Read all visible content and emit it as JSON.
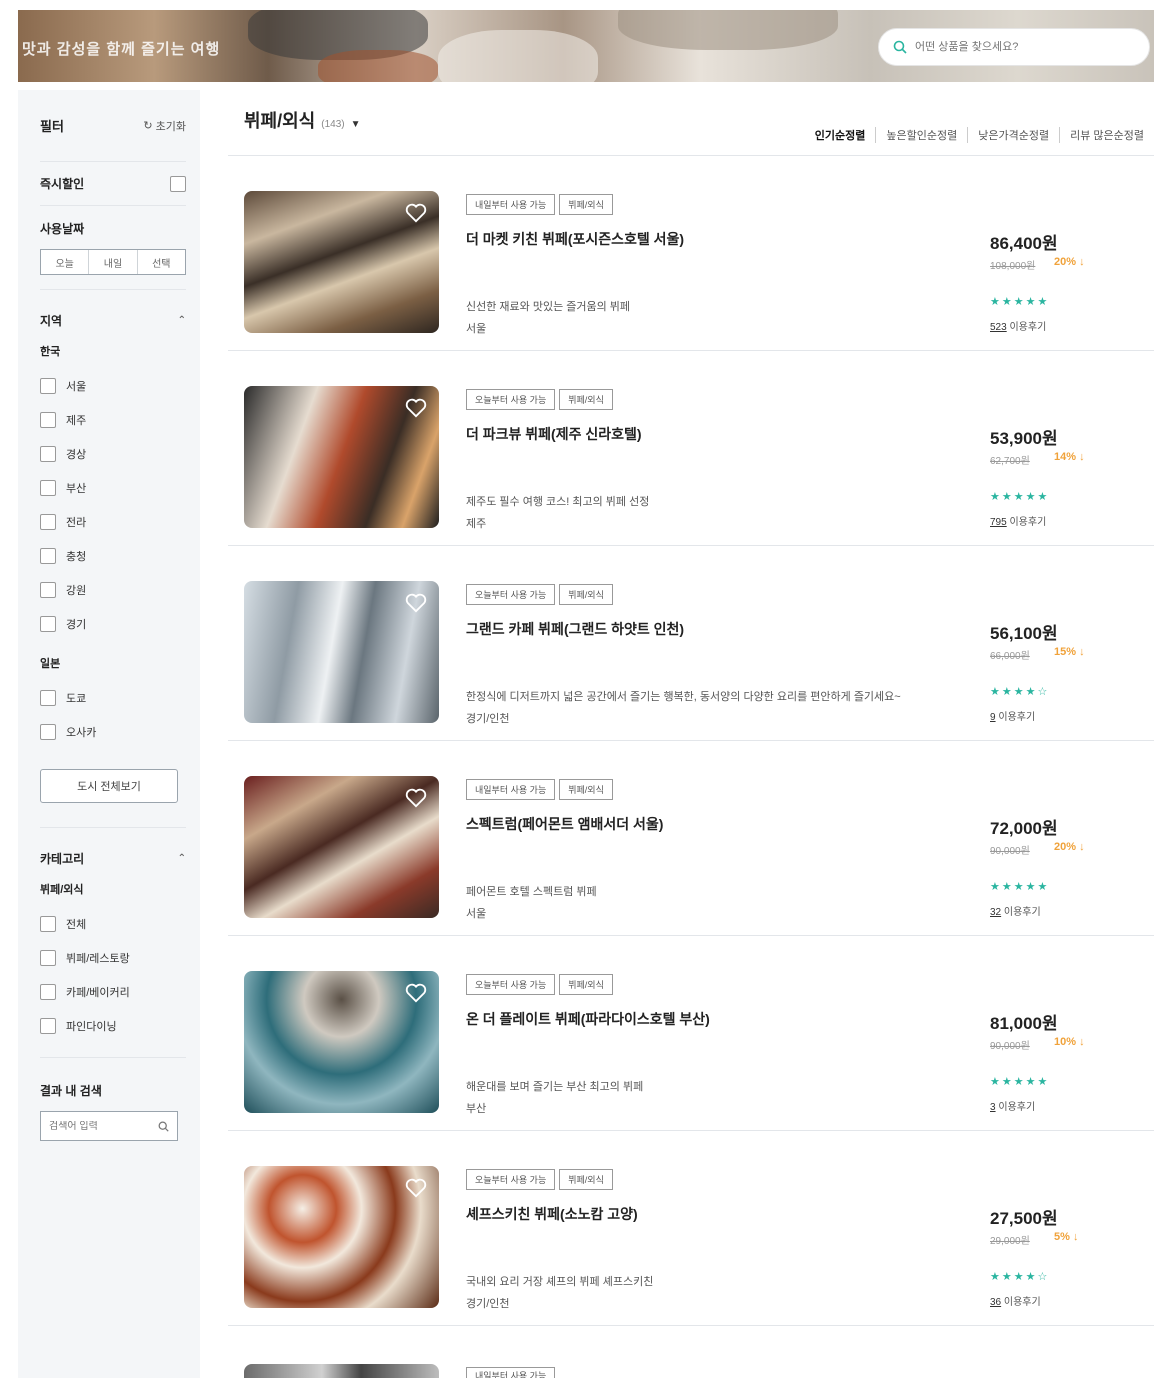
{
  "banner": {
    "text": "맛과 감성을 함께 즐기는 여행",
    "search_placeholder": "어떤 상품을 찾으세요?"
  },
  "sidebar": {
    "title": "필터",
    "reset": "초기화",
    "instant": "즉시할인",
    "date_title": "사용날짜",
    "date_options": [
      "오늘",
      "내일",
      "선택"
    ],
    "region_title": "지역",
    "korea_title": "한국",
    "korea_cities": [
      "서울",
      "제주",
      "경상",
      "부산",
      "전라",
      "충청",
      "강원",
      "경기"
    ],
    "japan_title": "일본",
    "japan_cities": [
      "도쿄",
      "오사카"
    ],
    "more_cities": "도시 전체보기",
    "category_title": "카테고리",
    "category_sub": "뷔페/외식",
    "categories": [
      "전체",
      "뷔페/레스토랑",
      "카페/베이커리",
      "파인다이닝"
    ],
    "result_search_title": "결과 내 검색",
    "result_search_placeholder": "검색어 입력"
  },
  "main": {
    "category_title": "뷔페/외식",
    "category_count": "(143)",
    "sorts": [
      "인기순정렬",
      "높은할인순정렬",
      "낮은가격순정렬",
      "리뷰 많은순정렬"
    ]
  },
  "products": [
    {
      "tags": [
        "내일부터 사용 가능",
        "뷔페/외식"
      ],
      "name": "더 마켓 키친 뷔페(포시즌스호텔 서울)",
      "desc": "신선한 재료와 맛있는 즐거움의 뷔페",
      "loc": "서울",
      "price": "86,400원",
      "orig": "108,000원",
      "disc": "20% ↓",
      "stars": "★★★★★",
      "review_count": "523",
      "review_label": "이용후기"
    },
    {
      "tags": [
        "오늘부터 사용 가능",
        "뷔페/외식"
      ],
      "name": "더 파크뷰 뷔페(제주 신라호텔)",
      "desc": "제주도 필수 여행 코스! 최고의 뷔페 선정",
      "loc": "제주",
      "price": "53,900원",
      "orig": "62,700원",
      "disc": "14% ↓",
      "stars": "★★★★★",
      "review_count": "795",
      "review_label": "이용후기"
    },
    {
      "tags": [
        "오늘부터 사용 가능",
        "뷔페/외식"
      ],
      "name": "그랜드 카페 뷔페(그랜드 하얏트 인천)",
      "desc": "한정식에 디저트까지 넓은 공간에서 즐기는 행복한, 동서양의 다양한 요리를 편안하게 즐기세요~",
      "loc": "경기/인천",
      "price": "56,100원",
      "orig": "66,000원",
      "disc": "15% ↓",
      "stars": "★★★★☆",
      "review_count": "9",
      "review_label": "이용후기"
    },
    {
      "tags": [
        "내일부터 사용 가능",
        "뷔페/외식"
      ],
      "name": "스펙트럼(페어몬트 앰배서더 서울)",
      "desc": "페어몬트 호텔 스펙트럼 뷔페",
      "loc": "서울",
      "price": "72,000원",
      "orig": "90,000원",
      "disc": "20% ↓",
      "stars": "★★★★★",
      "review_count": "32",
      "review_label": "이용후기"
    },
    {
      "tags": [
        "오늘부터 사용 가능",
        "뷔페/외식"
      ],
      "name": "온 더 플레이트 뷔페(파라다이스호텔 부산)",
      "desc": "해운대를 보며 즐기는 부산 최고의 뷔페",
      "loc": "부산",
      "price": "81,000원",
      "orig": "90,000원",
      "disc": "10% ↓",
      "stars": "★★★★★",
      "review_count": "3",
      "review_label": "이용후기"
    },
    {
      "tags": [
        "오늘부터 사용 가능",
        "뷔페/외식"
      ],
      "name": "셰프스키친 뷔페(소노캄 고양)",
      "desc": "국내외 요리 거장 셰프의 뷔페 셰프스키친",
      "loc": "경기/인천",
      "price": "27,500원",
      "orig": "29,000원",
      "disc": "5% ↓",
      "stars": "★★★★☆",
      "review_count": "36",
      "review_label": "이용후기"
    }
  ],
  "next_tag": "내일부터 사용 가능",
  "colors": {
    "accent_teal": "#2ab5a0",
    "discount_orange": "#f0a23a",
    "sidebar_bg": "#f4f6f8"
  }
}
